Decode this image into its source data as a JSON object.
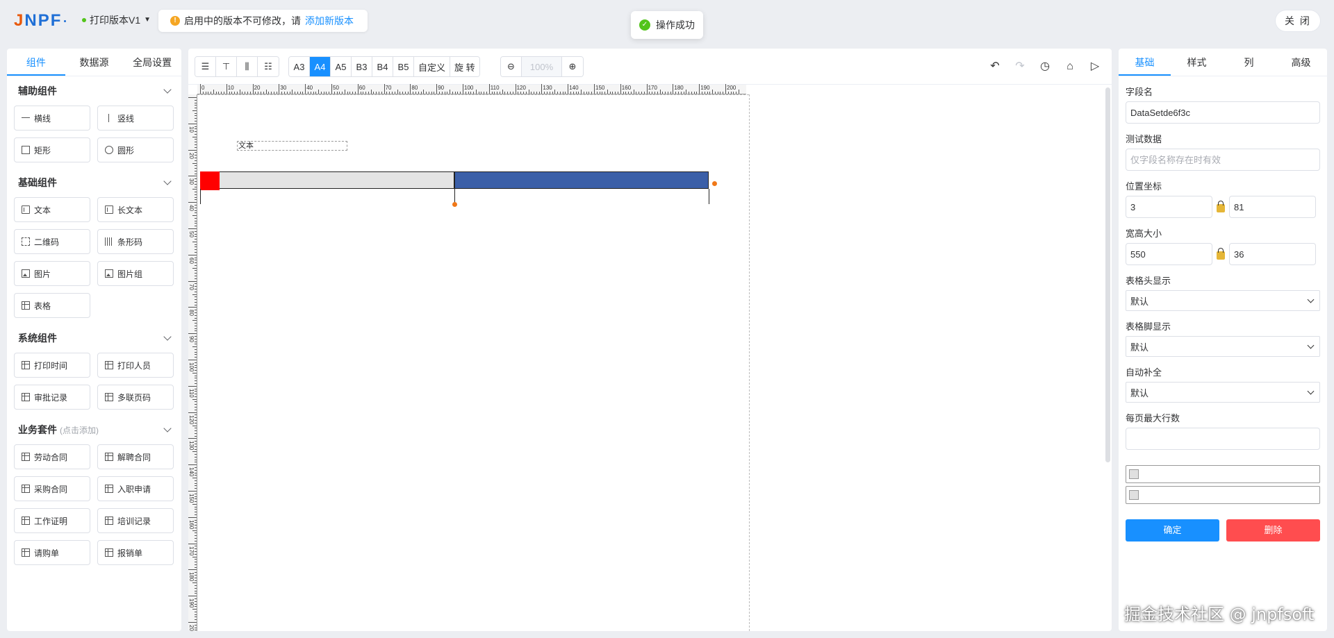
{
  "brand": {
    "logo_a": "J",
    "logo_b": "NPF"
  },
  "header": {
    "version_label": "打印版本V1",
    "notice_text": "启用中的版本不可修改，请",
    "notice_link": "添加新版本",
    "toast_text": "操作成功",
    "close_label": "关 闭"
  },
  "left": {
    "tabs": [
      "组件",
      "数据源",
      "全局设置"
    ],
    "groups": [
      {
        "title": "辅助组件",
        "hint": "",
        "items": [
          {
            "label": "横线",
            "icon": "hline-icon"
          },
          {
            "label": "竖线",
            "icon": "vline-icon"
          },
          {
            "label": "矩形",
            "icon": "rect-icon"
          },
          {
            "label": "圆形",
            "icon": "circle-icon"
          }
        ]
      },
      {
        "title": "基础组件",
        "hint": "",
        "items": [
          {
            "label": "文本",
            "icon": "text-icon"
          },
          {
            "label": "长文本",
            "icon": "longtext-icon"
          },
          {
            "label": "二维码",
            "icon": "qrcode-icon"
          },
          {
            "label": "条形码",
            "icon": "barcode-icon"
          },
          {
            "label": "图片",
            "icon": "image-icon"
          },
          {
            "label": "图片组",
            "icon": "image-group-icon"
          },
          {
            "label": "表格",
            "icon": "table-icon"
          }
        ]
      },
      {
        "title": "系统组件",
        "hint": "",
        "items": [
          {
            "label": "打印时间",
            "icon": "template-icon"
          },
          {
            "label": "打印人员",
            "icon": "template-icon"
          },
          {
            "label": "审批记录",
            "icon": "template-icon"
          },
          {
            "label": "多联页码",
            "icon": "template-icon"
          }
        ]
      },
      {
        "title": "业务套件",
        "hint": "(点击添加)",
        "items": [
          {
            "label": "劳动合同",
            "icon": "template-icon"
          },
          {
            "label": "解聘合同",
            "icon": "template-icon"
          },
          {
            "label": "采购合同",
            "icon": "template-icon"
          },
          {
            "label": "入职申请",
            "icon": "template-icon"
          },
          {
            "label": "工作证明",
            "icon": "template-icon"
          },
          {
            "label": "培训记录",
            "icon": "template-icon"
          },
          {
            "label": "请购单",
            "icon": "template-icon"
          },
          {
            "label": "报销单",
            "icon": "template-icon"
          }
        ]
      }
    ]
  },
  "toolbar": {
    "paper_sizes": [
      "A3",
      "A4",
      "A5",
      "B3",
      "B4",
      "B5",
      "自定义",
      "旋 转"
    ],
    "active_paper": "A4",
    "zoom": "100%",
    "right_icons": [
      "undo-icon",
      "redo-icon",
      "history-icon",
      "clear-icon",
      "preview-icon"
    ]
  },
  "canvas": {
    "ruler_h_labels": [
      "0",
      "10",
      "20",
      "30",
      "40",
      "50",
      "60",
      "70",
      "80",
      "90",
      "100",
      "110",
      "120",
      "130",
      "140",
      "150",
      "160",
      "170",
      "180",
      "190",
      "200"
    ],
    "ruler_v_labels": [
      "10",
      "20",
      "30",
      "40",
      "50",
      "60",
      "70",
      "80",
      "90",
      "100",
      "110",
      "120",
      "130",
      "140",
      "150",
      "160",
      "170",
      "180",
      "190",
      "200"
    ],
    "text_element": "文本"
  },
  "right": {
    "tabs": [
      "基础",
      "样式",
      "列",
      "高级"
    ],
    "field_name_label": "字段名",
    "field_name_value": "DataSetde6f3c",
    "test_data_label": "测试数据",
    "test_data_placeholder": "仅字段名称存在时有效",
    "position_label": "位置坐标",
    "pos_x": "3",
    "pos_y": "81",
    "size_label": "宽高大小",
    "width": "550",
    "height": "36",
    "header_display_label": "表格头显示",
    "header_display_value": "默认",
    "footer_display_label": "表格脚显示",
    "footer_display_value": "默认",
    "auto_fill_label": "自动补全",
    "auto_fill_value": "默认",
    "max_rows_label": "每页最大行数",
    "max_rows_value": "",
    "confirm_label": "确定",
    "delete_label": "删除"
  },
  "watermark": "掘金技术社区 @ jnpfsoft",
  "colors": {
    "accent": "#1890ff",
    "danger": "#ff4d4f",
    "bar_blue": "#3b5fa8",
    "bar_red": "#ff0000",
    "handle": "#f07818"
  }
}
